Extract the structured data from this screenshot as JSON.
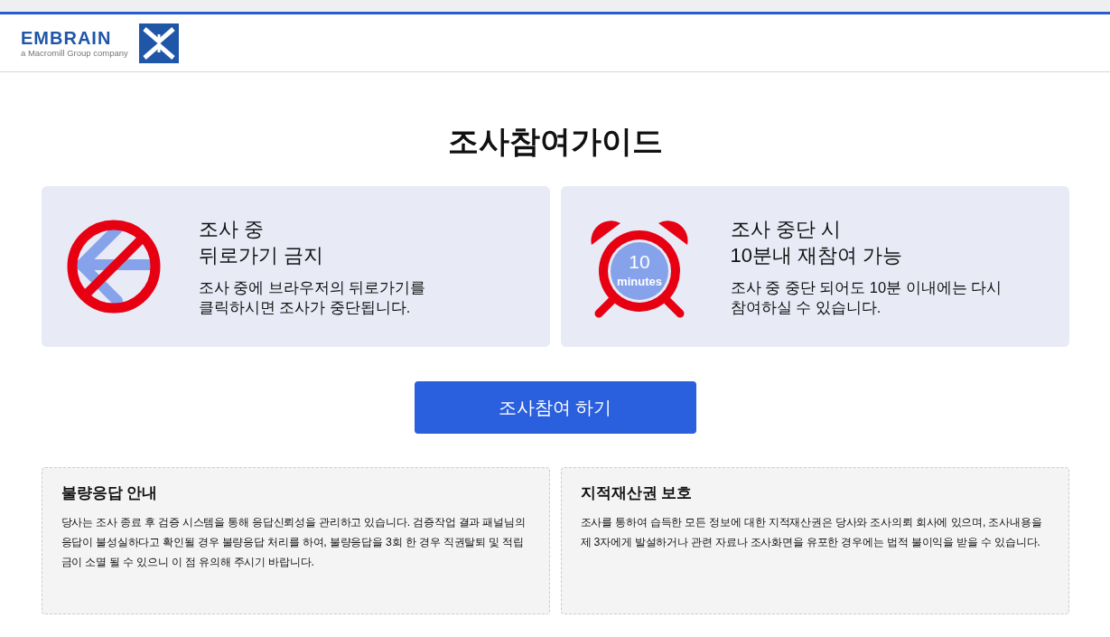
{
  "header": {
    "logo": {
      "name": "EMBRAIN",
      "tagline": "a Macromill Group company"
    }
  },
  "title": "조사참여가이드",
  "guide_cards": [
    {
      "kind": "no-back",
      "heading": [
        "조사 중",
        "뒤로가기 금지"
      ],
      "body": [
        "조사 중에 브라우저의 뒤로가기를",
        "클릭하시면 조사가 중단됩니다."
      ]
    },
    {
      "kind": "alarm",
      "icon_number": "10",
      "icon_unit": "minutes",
      "heading": [
        "조사 중단 시",
        "10분내 재참여 가능"
      ],
      "body": [
        "조사 중 중단 되어도 10분 이내에는 다시",
        "참여하실 수 있습니다."
      ]
    }
  ],
  "start_button": "조사참여 하기",
  "notices": [
    {
      "title": "불량응답 안내",
      "text": "당사는 조사 종료 후 검증 시스템을 통해 응답신뢰성을 관리하고 있습니다. 검증작업 결과 패널님의 응답이 불성실하다고 확인될 경우 불량응답 처리를 하여, 불량응답을 3회 한 경우 직권탈퇴 및 적립금이 소멸 될 수 있으니 이 점 유의해 주시기 바랍니다."
    },
    {
      "title": "지적재산권 보호",
      "text": "조사를 통하여 습득한 모든 정보에 대한 지적재산권은 당사와 조사의뢰 회사에 있으며, 조사내용을 제 3자에게 발설하거나 관련 자료나 조사화면을 유포한 경우에는 법적 불이익을 받을 수 있습니다."
    }
  ]
}
